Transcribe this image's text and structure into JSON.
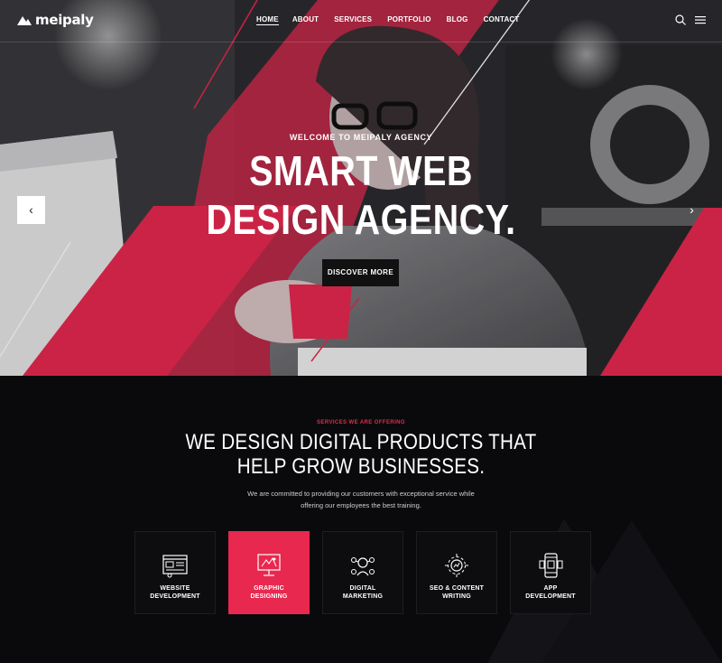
{
  "brand": {
    "name": "meipaly",
    "accent": "#e8284f"
  },
  "nav": {
    "items": [
      {
        "label": "HOME",
        "active": true
      },
      {
        "label": "ABOUT",
        "active": false
      },
      {
        "label": "SERVICES",
        "active": false
      },
      {
        "label": "PORTFOLIO",
        "active": false
      },
      {
        "label": "BLOG",
        "active": false
      },
      {
        "label": "CONTACT",
        "active": false
      }
    ],
    "icons": [
      "search-icon",
      "hamburger-menu-icon"
    ]
  },
  "hero": {
    "subtitle": "WELCOME TO MEIPALY AGENCY",
    "title_line1": "SMART WEB",
    "title_line2": "DESIGN AGENCY.",
    "button_label": "DISCOVER MORE",
    "prev_icon": "chevron-left-icon",
    "next_icon": "chevron-right-icon"
  },
  "services": {
    "kicker": "SERVICES WE ARE OFFERING",
    "title_line1": "WE DESIGN DIGITAL PRODUCTS THAT",
    "title_line2": "HELP GROW BUSINESSES.",
    "desc_line1": "We are committed to providing our customers with exceptional service while",
    "desc_line2": "offering our employees the best training.",
    "cards": [
      {
        "line1": "WEBSITE",
        "line2": "DEVELOPMENT",
        "icon": "web-layout-icon",
        "active": false
      },
      {
        "line1": "GRAPHIC",
        "line2": "DESIGNING",
        "icon": "monitor-design-icon",
        "active": true
      },
      {
        "line1": "DIGITAL",
        "line2": "MARKETING",
        "icon": "network-people-icon",
        "active": false
      },
      {
        "line1": "SEO & CONTENT",
        "line2": "WRITING",
        "icon": "gear-analytics-icon",
        "active": false
      },
      {
        "line1": "APP",
        "line2": "DEVELOPMENT",
        "icon": "mobile-app-icon",
        "active": false
      }
    ]
  }
}
